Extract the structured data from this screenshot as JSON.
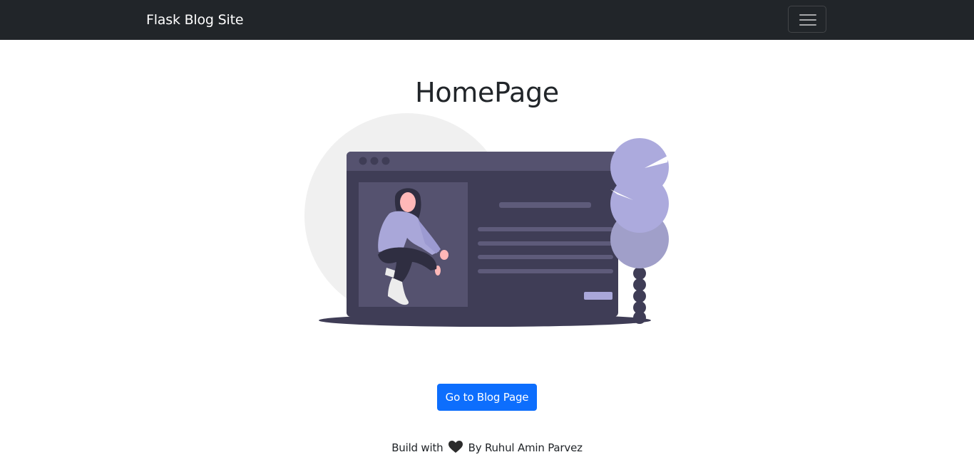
{
  "navbar": {
    "brand": "Flask Blog Site",
    "toggle_icon": "hamburger-menu-icon"
  },
  "main": {
    "title": "HomePage",
    "illustration": "woman-sitting-in-browser-window-illustration",
    "button_label": "Go to Blog Page"
  },
  "footer": {
    "before_icon": "Build with",
    "icon": "heart-icon",
    "after_icon": "By Ruhul Amin Parvez"
  },
  "colors": {
    "navbar_bg": "#212529",
    "primary": "#0d6efd",
    "illustration_dark": "#3f3d56",
    "illustration_accent": "#a9a7d9"
  }
}
